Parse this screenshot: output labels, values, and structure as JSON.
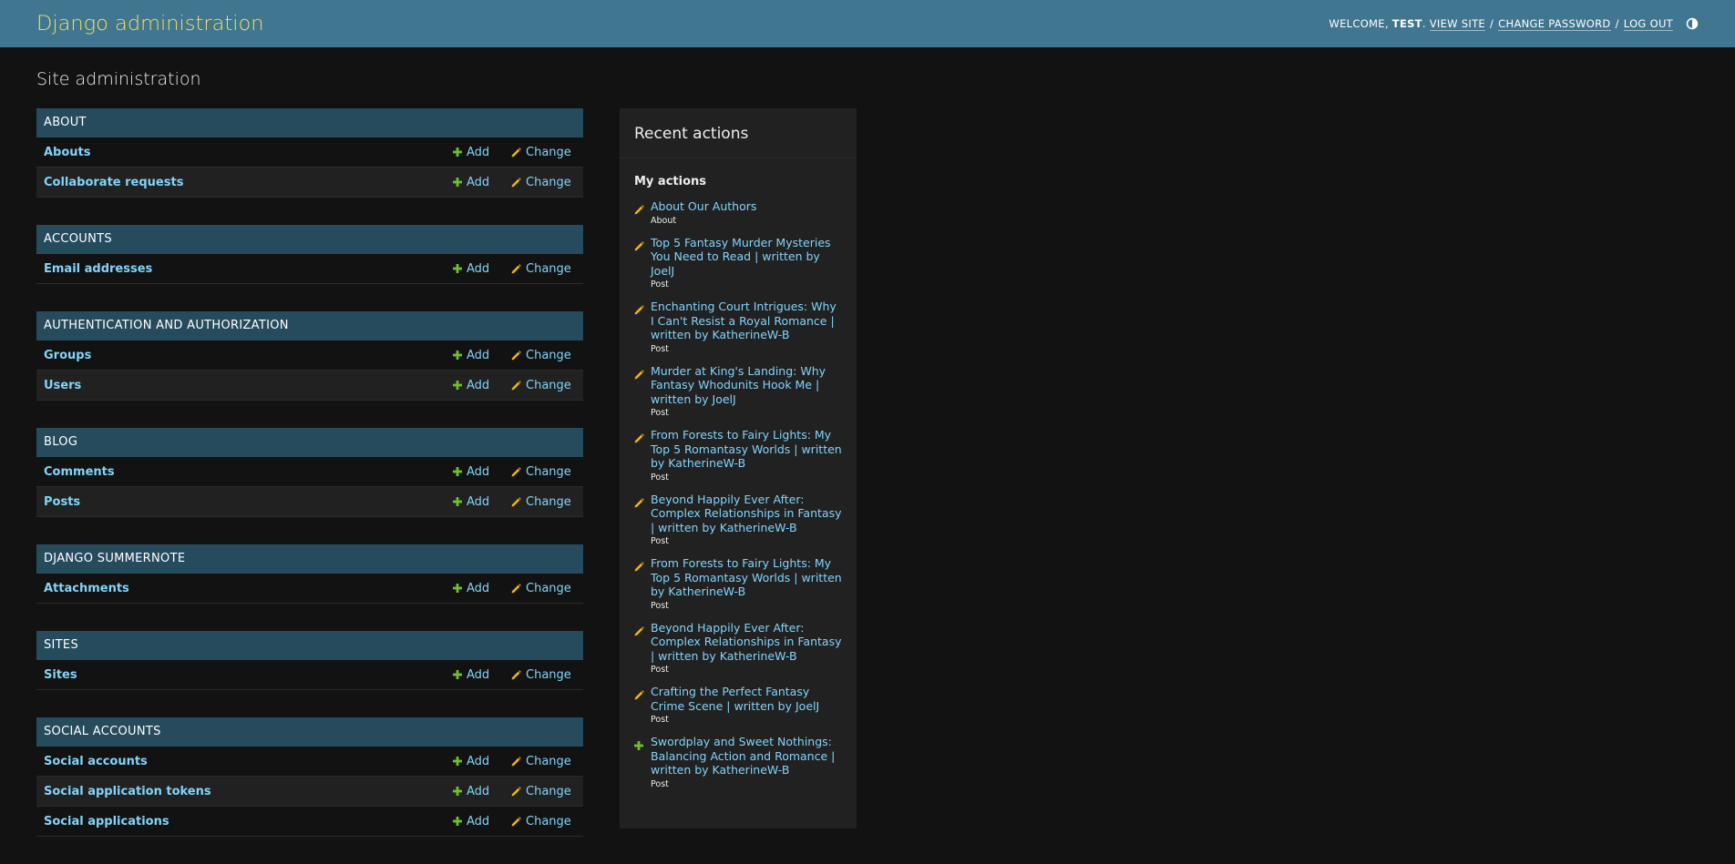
{
  "header": {
    "branding": "Django administration",
    "welcome": "WELCOME,",
    "username": "TEST",
    "view_site": "VIEW SITE",
    "change_password": "CHANGE PASSWORD",
    "log_out": "LOG OUT",
    "separator": "/",
    "toggle_icon": "theme-toggle-icon"
  },
  "page_title": "Site administration",
  "labels": {
    "add": "Add",
    "change": "Change"
  },
  "colors": {
    "header_bg": "#417690",
    "branding": "#f5dd5d",
    "module_caption_bg": "#264b5d",
    "link": "#81d4fa",
    "add_icon": "#70bf2b",
    "change_icon": "#efb80b",
    "background": "#121212"
  },
  "apps": [
    {
      "name": "ABOUT",
      "models": [
        "Abouts",
        "Collaborate requests"
      ]
    },
    {
      "name": "ACCOUNTS",
      "models": [
        "Email addresses"
      ]
    },
    {
      "name": "AUTHENTICATION AND AUTHORIZATION",
      "models": [
        "Groups",
        "Users"
      ]
    },
    {
      "name": "BLOG",
      "models": [
        "Comments",
        "Posts"
      ]
    },
    {
      "name": "DJANGO SUMMERNOTE",
      "models": [
        "Attachments"
      ]
    },
    {
      "name": "SITES",
      "models": [
        "Sites"
      ]
    },
    {
      "name": "SOCIAL ACCOUNTS",
      "models": [
        "Social accounts",
        "Social application tokens",
        "Social applications"
      ]
    }
  ],
  "recent_actions": {
    "title": "Recent actions",
    "subtitle": "My actions",
    "items": [
      {
        "icon": "change",
        "title": "About Our Authors",
        "type": "About"
      },
      {
        "icon": "change",
        "title": "Top 5 Fantasy Murder Mysteries You Need to Read | written by JoelJ",
        "type": "Post"
      },
      {
        "icon": "change",
        "title": "Enchanting Court Intrigues: Why I Can't Resist a Royal Romance | written by KatherineW-B",
        "type": "Post"
      },
      {
        "icon": "change",
        "title": "Murder at King's Landing: Why Fantasy Whodunits Hook Me | written by JoelJ",
        "type": "Post"
      },
      {
        "icon": "change",
        "title": "From Forests to Fairy Lights: My Top 5 Romantasy Worlds | written by KatherineW-B",
        "type": "Post"
      },
      {
        "icon": "change",
        "title": "Beyond Happily Ever After: Complex Relationships in Fantasy | written by KatherineW-B",
        "type": "Post"
      },
      {
        "icon": "change",
        "title": "From Forests to Fairy Lights: My Top 5 Romantasy Worlds | written by KatherineW-B",
        "type": "Post"
      },
      {
        "icon": "change",
        "title": "Beyond Happily Ever After: Complex Relationships in Fantasy | written by KatherineW-B",
        "type": "Post"
      },
      {
        "icon": "change",
        "title": "Crafting the Perfect Fantasy Crime Scene | written by JoelJ",
        "type": "Post"
      },
      {
        "icon": "add",
        "title": "Swordplay and Sweet Nothings: Balancing Action and Romance | written by KatherineW-B",
        "type": "Post"
      }
    ]
  }
}
